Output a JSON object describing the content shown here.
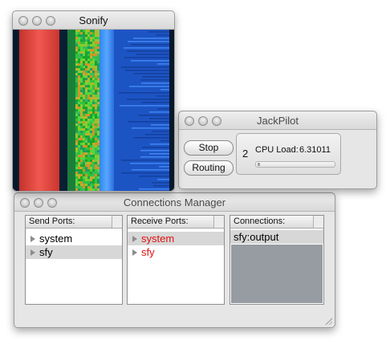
{
  "sonify": {
    "title": "Sonify"
  },
  "jackpilot": {
    "title": "JackPilot",
    "stop_label": "Stop",
    "routing_label": "Routing",
    "client_count": "2",
    "cpu_label": "CPU Load:",
    "cpu_value": "6.31011"
  },
  "connections_manager": {
    "title": "Connections Manager",
    "send_ports": {
      "header": "Send Ports:",
      "items": [
        "system",
        "sfy"
      ]
    },
    "receive_ports": {
      "header": "Receive Ports:",
      "items": [
        "system",
        "sfy"
      ]
    },
    "connections": {
      "header": "Connections:",
      "items": [
        "sfy:output"
      ]
    }
  },
  "colors": {
    "receive_port_text": "#e01010",
    "connections_fill": "#979ca2",
    "spectro_red": "#e8453f",
    "spectro_green": "#27b52e",
    "spectro_blue": "#2a6ee0",
    "spectro_dark": "#0a1f33"
  }
}
